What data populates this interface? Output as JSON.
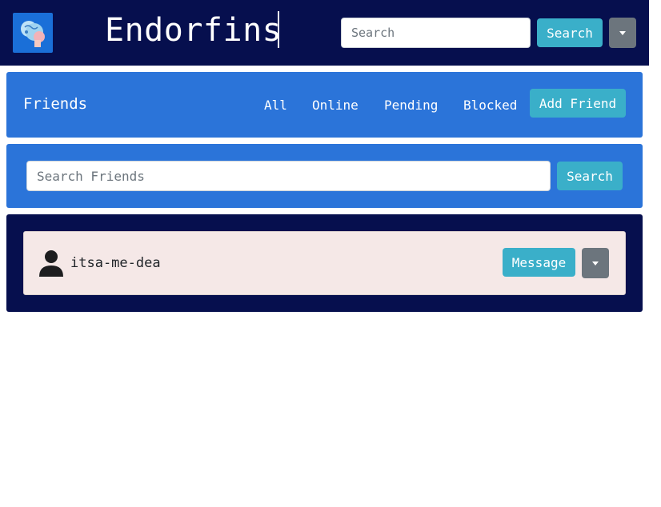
{
  "navbar": {
    "brand": "Endorfins",
    "search_placeholder": "Search",
    "search_button": "Search"
  },
  "friends_bar": {
    "title": "Friends",
    "tabs": [
      {
        "label": "All"
      },
      {
        "label": "Online"
      },
      {
        "label": "Pending"
      },
      {
        "label": "Blocked"
      }
    ],
    "add_friend_button": "Add Friend"
  },
  "friends_search": {
    "placeholder": "Search Friends",
    "button": "Search"
  },
  "friends_list": [
    {
      "username": "itsa-me-dea",
      "message_button": "Message"
    }
  ],
  "colors": {
    "navbar_bg": "#060f4e",
    "panel_blue": "#2b74d9",
    "info_button": "#3aafc9",
    "secondary_button": "#6c757d",
    "card_bg": "#f5e8e7"
  }
}
